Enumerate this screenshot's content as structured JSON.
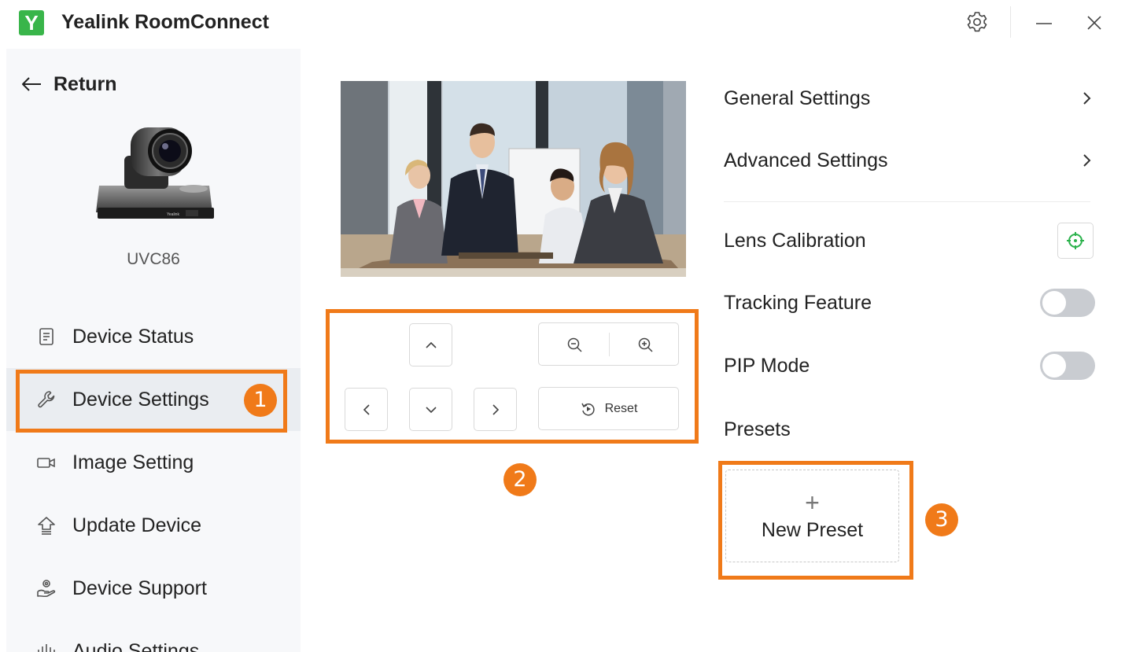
{
  "titlebar": {
    "logo_letter": "Y",
    "title": "Yealink RoomConnect",
    "icons": [
      "gear-icon",
      "minimize-icon",
      "close-icon"
    ]
  },
  "sidebar": {
    "return_label": "Return",
    "device_model": "UVC86",
    "device_brand_mark": "Yealink",
    "items": [
      {
        "label": "Device Status",
        "icon": "document-icon"
      },
      {
        "label": "Device Settings",
        "icon": "wrench-icon",
        "active": true
      },
      {
        "label": "Image Setting",
        "icon": "camera-icon"
      },
      {
        "label": "Update Device",
        "icon": "upload-icon"
      },
      {
        "label": "Device Support",
        "icon": "support-icon"
      },
      {
        "label": "Audio Settings",
        "icon": "audio-bars-icon"
      }
    ]
  },
  "ptz": {
    "reset_label": "Reset",
    "icons": [
      "arrow-up-icon",
      "arrow-down-icon",
      "arrow-left-icon",
      "arrow-right-icon",
      "zoom-out-icon",
      "zoom-in-icon",
      "reset-icon"
    ]
  },
  "settings": {
    "general": "General Settings",
    "advanced": "Advanced Settings",
    "lens_calibration": "Lens Calibration",
    "tracking": {
      "label": "Tracking Feature",
      "enabled": false
    },
    "pip": {
      "label": "PIP Mode",
      "enabled": false
    },
    "presets": "Presets",
    "new_preset": "New Preset"
  },
  "callouts": {
    "one": "1",
    "two": "2",
    "three": "3"
  },
  "colors": {
    "accent": "#f07a19",
    "brand": "#39b54a",
    "calibration_icon": "#2bb24c",
    "toggle_off": "#c9ccd1",
    "sidebar_bg": "#f7f8fa",
    "active_bg": "#eaedf1"
  }
}
